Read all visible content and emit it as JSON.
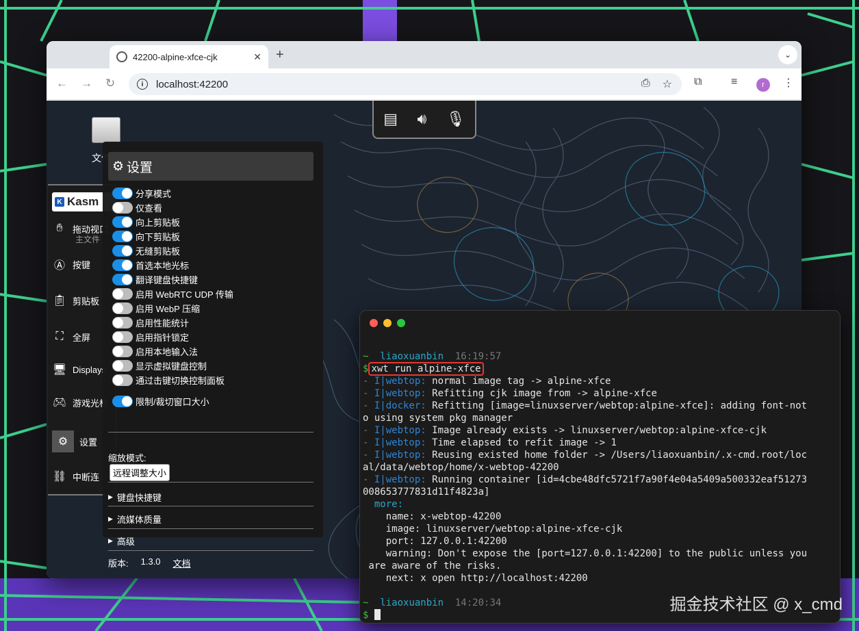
{
  "browser": {
    "tab_title": "42200-alpine-xfce-cjk",
    "new_tab": "+",
    "close": "✕",
    "url": "localhost:42200",
    "avatar_letter": "r"
  },
  "kasm_top_icons": [
    "server-icon",
    "volume-icon",
    "microphone-icon"
  ],
  "desktop_icon": {
    "label": "文件系"
  },
  "sidebar": {
    "logo": "Kasm",
    "items": [
      {
        "label": "拖动视口",
        "icon": "hand-icon"
      },
      {
        "label": "按键",
        "icon": "keyboard-key-icon"
      },
      {
        "label": "剪贴板",
        "icon": "clipboard-icon"
      },
      {
        "label": "全屏",
        "icon": "fullscreen-icon"
      },
      {
        "label": "Displays",
        "icon": "monitor-icon"
      },
      {
        "label": "游戏光标",
        "icon": "gamepad-icon"
      },
      {
        "label": "设置",
        "icon": "gear-icon"
      },
      {
        "label": "中断连",
        "icon": "disconnect-icon"
      }
    ],
    "sub_label": "主文件"
  },
  "settings": {
    "title": "设置",
    "toggles": [
      {
        "label": "分享模式",
        "on": true
      },
      {
        "label": "仅查看",
        "on": false
      },
      {
        "label": "向上剪贴板",
        "on": true
      },
      {
        "label": "向下剪贴板",
        "on": true
      },
      {
        "label": "无缝剪贴板",
        "on": true
      },
      {
        "label": "首选本地光标",
        "on": true
      },
      {
        "label": "翻译键盘快捷键",
        "on": true
      },
      {
        "label": "启用 WebRTC UDP 传输",
        "on": false
      },
      {
        "label": "启用 WebP 压缩",
        "on": false
      },
      {
        "label": "启用性能统计",
        "on": false
      },
      {
        "label": "启用指针锁定",
        "on": false
      },
      {
        "label": "启用本地输入法",
        "on": false
      },
      {
        "label": "显示虚拟键盘控制",
        "on": false
      },
      {
        "label": "通过击键切换控制面板",
        "on": false
      },
      {
        "label": "限制/裁切窗口大小",
        "on": true
      }
    ],
    "scale_mode_label": "缩放模式:",
    "scale_mode_value": "远程调整大小",
    "sections": [
      "键盘快捷键",
      "流媒体质量",
      "高级"
    ],
    "version_label": "版本:",
    "version_value": "1.3.0",
    "docs_link": "文档"
  },
  "terminal": {
    "lines": [
      {
        "kind": "prompt-head",
        "user": "liaoxuanbin",
        "time": "16:19:57"
      },
      {
        "kind": "command",
        "prompt": "$",
        "cmd": "xwt run alpine-xfce"
      },
      {
        "kind": "log",
        "tag": "I|webtop:",
        "text": "normal image tag -> alpine-xfce"
      },
      {
        "kind": "log",
        "tag": "I|webtop:",
        "text": "Refitting cjk image from -> alpine-xfce"
      },
      {
        "kind": "log",
        "tag": "I|docker:",
        "text": "Refitting [image=linuxserver/webtop:alpine-xfce]: adding font-not"
      },
      {
        "kind": "plain",
        "text": "o using system pkg manager"
      },
      {
        "kind": "log",
        "tag": "I|webtop:",
        "text": "Image already exists -> linuxserver/webtop:alpine-xfce-cjk"
      },
      {
        "kind": "log",
        "tag": "I|webtop:",
        "text": "Time elapsed to refit image -> 1"
      },
      {
        "kind": "log",
        "tag": "I|webtop:",
        "text": "Reusing existed home folder -> /Users/liaoxuanbin/.x-cmd.root/loc"
      },
      {
        "kind": "plain",
        "text": "al/data/webtop/home/x-webtop-42200"
      },
      {
        "kind": "log",
        "tag": "I|webtop:",
        "text": "Running container [id=4cbe48dfc5721f7a90f4e04a5409a500332eaf51273"
      },
      {
        "kind": "plain",
        "text": "008653777831d11f4823a]"
      },
      {
        "kind": "more",
        "text": "  more:"
      },
      {
        "kind": "plain",
        "text": "    name: x-webtop-42200"
      },
      {
        "kind": "plain",
        "text": "    image: linuxserver/webtop:alpine-xfce-cjk"
      },
      {
        "kind": "plain",
        "text": "    port: 127.0.0.1:42200"
      },
      {
        "kind": "plain",
        "text": "    warning: Don't expose the [port=127.0.0.1:42200] to the public unless you"
      },
      {
        "kind": "plain",
        "text": " are aware of the risks."
      },
      {
        "kind": "plain",
        "text": "    next: x open http://localhost:42200"
      },
      {
        "kind": "blank",
        "text": ""
      },
      {
        "kind": "prompt-head",
        "user": "liaoxuanbin",
        "time": "14:20:34"
      },
      {
        "kind": "cursor",
        "prompt": "$"
      }
    ]
  },
  "watermark": "掘金技术社区 @ x_cmd",
  "colors": {
    "toggle_on": "#1a8fe8",
    "toggle_off": "#bdbdbd",
    "terminal_green": "#3fbf3f",
    "terminal_cyan": "#2aa7c9",
    "highlight_red": "#e53935",
    "grid_green": "#3ecf8e",
    "bg_purple": "#7b4de0"
  }
}
